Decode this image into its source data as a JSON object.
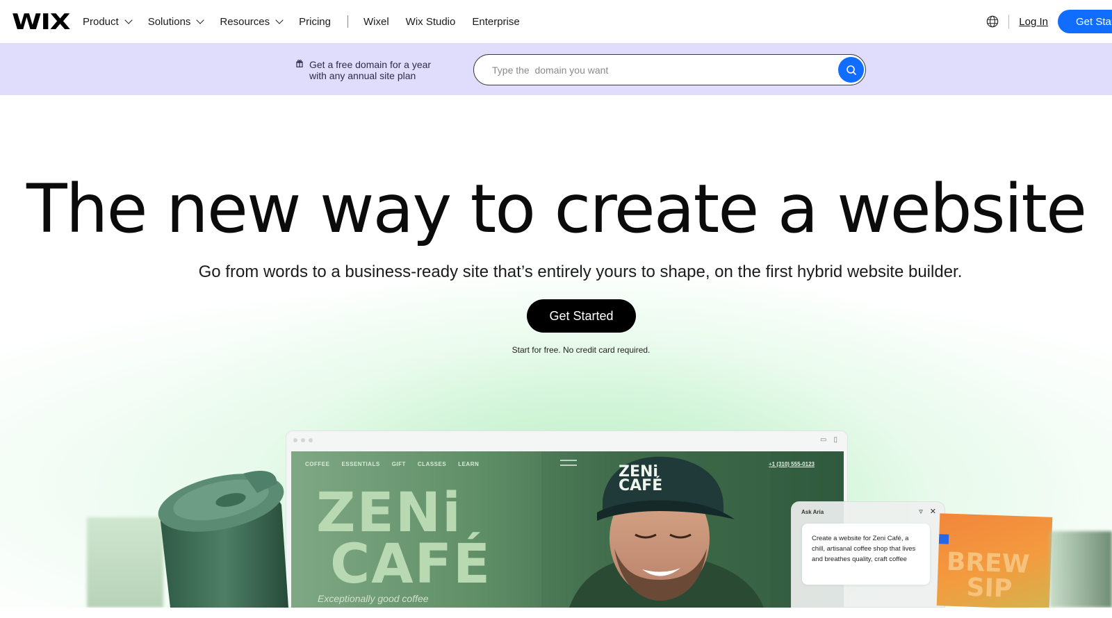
{
  "nav": {
    "logo": "WIX",
    "items": [
      {
        "label": "Product",
        "dropdown": true
      },
      {
        "label": "Solutions",
        "dropdown": true
      },
      {
        "label": "Resources",
        "dropdown": true
      },
      {
        "label": "Pricing",
        "dropdown": false
      }
    ],
    "secondary_items": [
      "Wixel",
      "Wix Studio",
      "Enterprise"
    ],
    "login_label": "Log In",
    "get_started_label": "Get Started"
  },
  "promo": {
    "line1": "Get a free domain for a year",
    "line2": "with any annual site plan",
    "search_placeholder": "Type the  domain you want"
  },
  "hero": {
    "headline": "The new way to create a website",
    "subhead": "Go from words to a business-ready site that’s entirely yours to shape, on the first hybrid website builder.",
    "cta_label": "Get Started",
    "cta_note": "Start for free. No credit card required."
  },
  "mockup": {
    "site_nav": [
      "COFFEE",
      "ESSENTIALS",
      "GIFT",
      "CLASSES",
      "LEARN"
    ],
    "phone": "+1 (310) 555-0123",
    "brand_big_line1": "ZENi",
    "brand_big_line2": "CAFÉ",
    "tagline": "Exceptionally good coffee",
    "cap_logo_line1": "ZENi",
    "cap_logo_line2": "CAFÉ"
  },
  "aria": {
    "title": "Ask Aria",
    "prompt": "Create a website for Zeni Café, a chill, artisanal coffee shop that lives and breathes quality, craft coffee"
  },
  "brew": {
    "line1": "BREW",
    "line2": "SIP"
  },
  "colors": {
    "accent": "#116dff",
    "promo_bg": "#e0dcfb",
    "cta_bg": "#000000"
  }
}
